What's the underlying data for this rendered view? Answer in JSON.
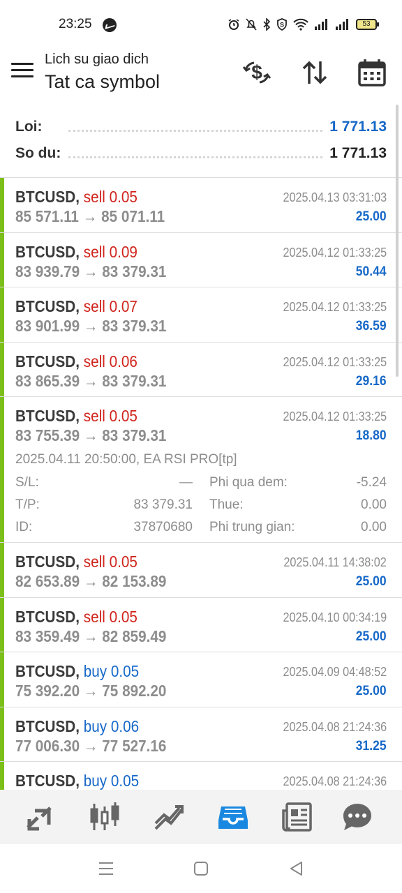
{
  "status_bar": {
    "time": "23:25",
    "battery": "53"
  },
  "header": {
    "subtitle": "Lich su giao dich",
    "title": "Tat ca symbol"
  },
  "summary": {
    "profit_label": "Loi:",
    "profit_value": "1 771.13",
    "balance_label": "So du:",
    "balance_value": "1 771.13",
    "profit_color": "#1668c8"
  },
  "colors": {
    "bar": "#7cbf1a",
    "sell": "#d0231b",
    "buy": "#1668c8",
    "active_nav": "#1a88e0"
  },
  "deals": [
    {
      "symbol": "BTCUSD,",
      "side": "sell",
      "lots": "sell 0.05",
      "time": "2025.04.13 03:31:03",
      "open": "85 571.11",
      "close": "85 071.11",
      "profit": "25.00"
    },
    {
      "symbol": "BTCUSD,",
      "side": "sell",
      "lots": "sell 0.09",
      "time": "2025.04.12 01:33:25",
      "open": "83 939.79",
      "close": "83 379.31",
      "profit": "50.44"
    },
    {
      "symbol": "BTCUSD,",
      "side": "sell",
      "lots": "sell 0.07",
      "time": "2025.04.12 01:33:25",
      "open": "83 901.99",
      "close": "83 379.31",
      "profit": "36.59"
    },
    {
      "symbol": "BTCUSD,",
      "side": "sell",
      "lots": "sell 0.06",
      "time": "2025.04.12 01:33:25",
      "open": "83 865.39",
      "close": "83 379.31",
      "profit": "29.16"
    },
    {
      "symbol": "BTCUSD,",
      "side": "sell",
      "lots": "sell 0.05",
      "time": "2025.04.12 01:33:25",
      "open": "83 755.39",
      "close": "83 379.31",
      "profit": "18.80",
      "details": {
        "opened": "2025.04.11 20:50:00, EA RSI PRO[tp]",
        "sl_label": "S/L:",
        "sl_value": "—",
        "tp_label": "T/P:",
        "tp_value": "83 379.31",
        "id_label": "ID:",
        "id_value": "37870680",
        "swap_label": "Phi qua dem:",
        "swap_value": "-5.24",
        "tax_label": "Thue:",
        "tax_value": "0.00",
        "comm_label": "Phi trung gian:",
        "comm_value": "0.00"
      }
    },
    {
      "symbol": "BTCUSD,",
      "side": "sell",
      "lots": "sell 0.05",
      "time": "2025.04.11 14:38:02",
      "open": "82 653.89",
      "close": "82 153.89",
      "profit": "25.00"
    },
    {
      "symbol": "BTCUSD,",
      "side": "sell",
      "lots": "sell 0.05",
      "time": "2025.04.10 00:34:19",
      "open": "83 359.49",
      "close": "82 859.49",
      "profit": "25.00"
    },
    {
      "symbol": "BTCUSD,",
      "side": "buy",
      "lots": "buy 0.05",
      "time": "2025.04.09 04:48:52",
      "open": "75 392.20",
      "close": "75 892.20",
      "profit": "25.00"
    },
    {
      "symbol": "BTCUSD,",
      "side": "buy",
      "lots": "buy 0.06",
      "time": "2025.04.08 21:24:36",
      "open": "77 006.30",
      "close": "77 527.16",
      "profit": "31.25"
    },
    {
      "symbol": "BTCUSD,",
      "side": "buy",
      "lots": "buy 0.05",
      "time": "2025.04.08 21:24:36",
      "open": "",
      "close": "",
      "profit": ""
    }
  ],
  "arrow": "→",
  "bottom_nav": [
    {
      "icon": "quotes-icon"
    },
    {
      "icon": "chart-icon"
    },
    {
      "icon": "trade-icon"
    },
    {
      "icon": "history-icon",
      "active": true
    },
    {
      "icon": "news-icon"
    },
    {
      "icon": "chat-icon"
    }
  ]
}
